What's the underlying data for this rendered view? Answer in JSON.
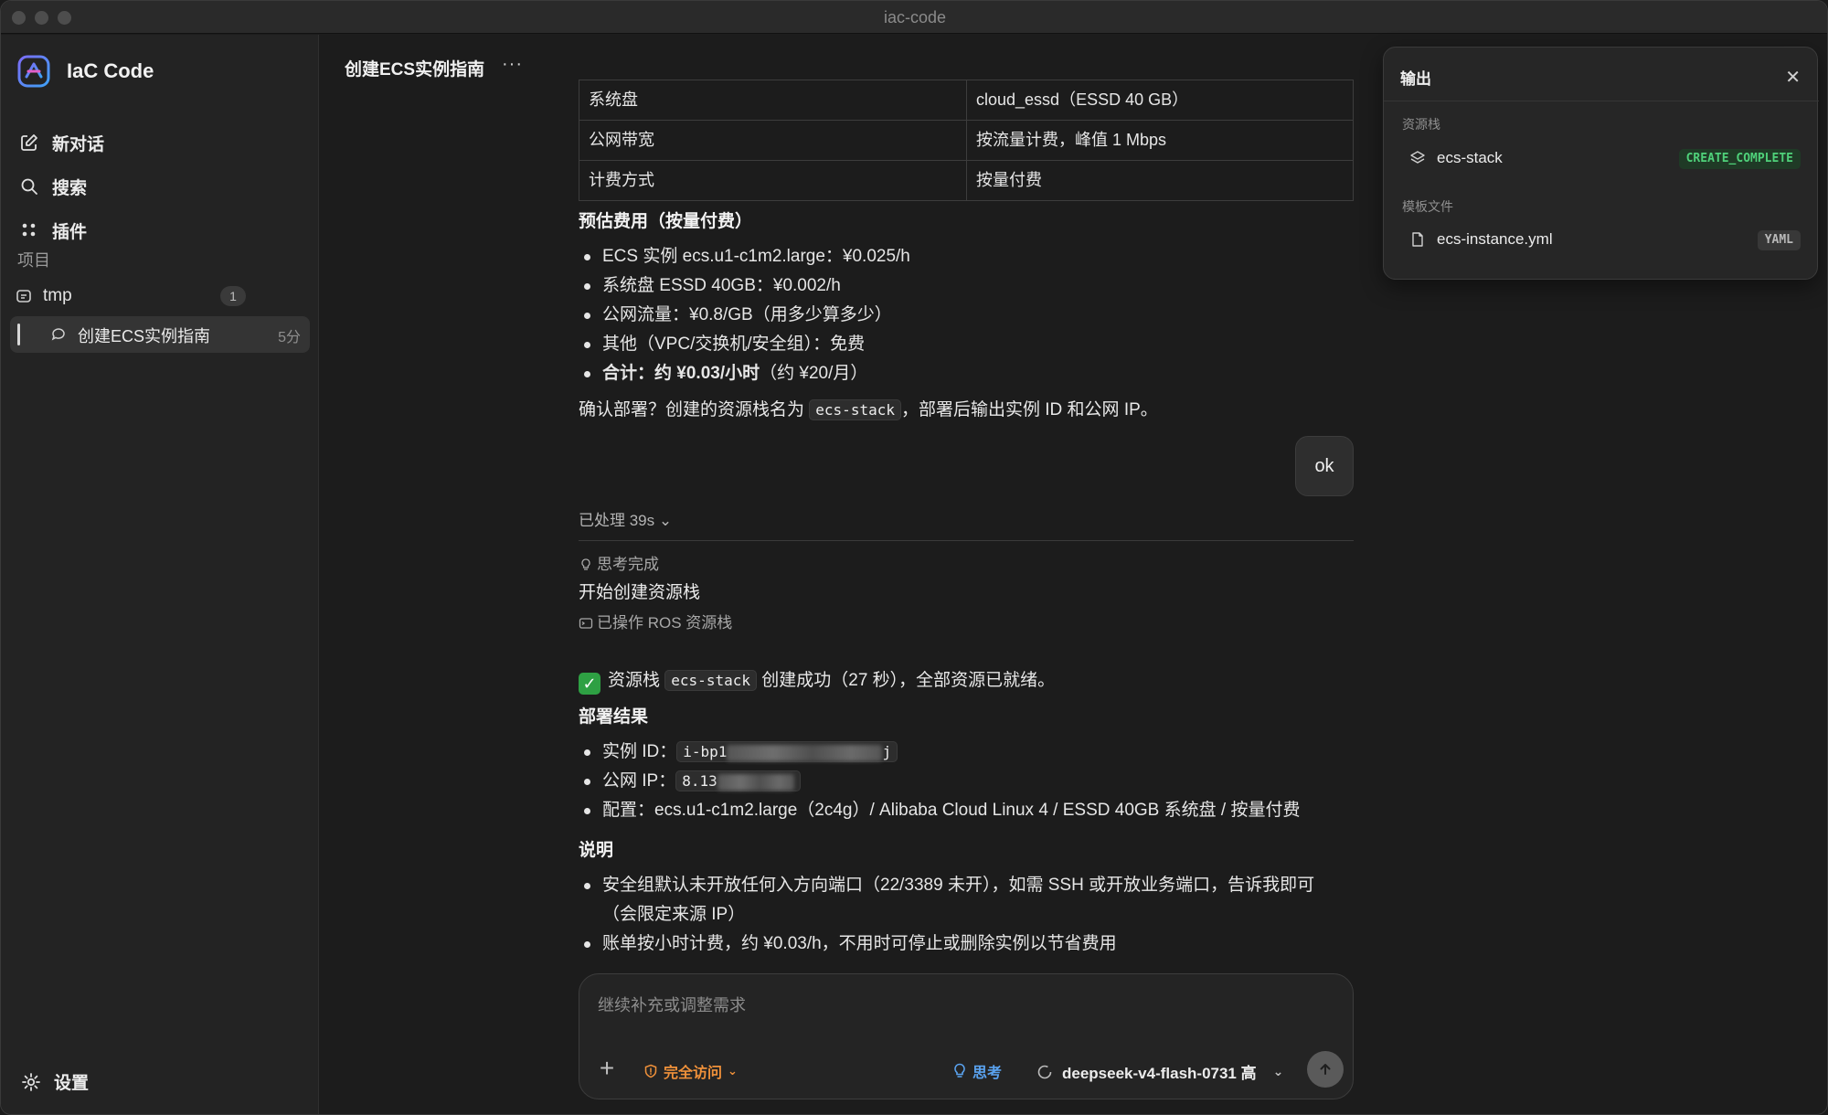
{
  "window": {
    "title": "iac-code"
  },
  "sidebar": {
    "brand": "IaC Code",
    "nav": [
      {
        "label": "新对话",
        "icon": "new-chat-icon"
      },
      {
        "label": "搜索",
        "icon": "search-icon"
      },
      {
        "label": "插件",
        "icon": "plugins-icon"
      }
    ],
    "projects_label": "项目",
    "project": {
      "name": "tmp",
      "count": "1"
    },
    "chat": {
      "title": "创建ECS实例指南",
      "age": "5分"
    },
    "settings_label": "设置"
  },
  "header": {
    "title": "创建ECS实例指南",
    "more": "···"
  },
  "spec_table": [
    [
      "系统盘",
      "cloud_essd（ESSD 40 GB）"
    ],
    [
      "公网带宽",
      "按流量计费，峰值 1 Mbps"
    ],
    [
      "计费方式",
      "按量付费"
    ]
  ],
  "cost": {
    "heading": "预估费用（按量付费）",
    "items": [
      "ECS 实例 ecs.u1-c1m2.large：¥0.025/h",
      "系统盘 ESSD 40GB：¥0.002/h",
      "公网流量：¥0.8/GB（用多少算多少）",
      "其他（VPC/交换机/安全组）：免费"
    ],
    "total_bold": "合计：约 ¥0.03/小时",
    "total_rest": "（约 ¥20/月）"
  },
  "confirm": {
    "pre": "确认部署？创建的资源栈名为 ",
    "code": "ecs-stack",
    "post": "，部署后输出实例 ID 和公网 IP。"
  },
  "user_message": "ok",
  "processed": "已处理 39s ⌄",
  "thinking_done": "思考完成",
  "start_line": "开始创建资源栈",
  "ros_line": "已操作 ROS 资源栈",
  "success": {
    "check": "✓",
    "pre": "资源栈 ",
    "code": "ecs-stack",
    "post": " 创建成功（27 秒），全部资源已就绪。"
  },
  "results": {
    "heading": "部署结果",
    "instance_label": "实例 ID：",
    "instance_prefix": "i-bp1",
    "instance_suffix": "j",
    "ip_label": "公网 IP：",
    "ip_prefix": "8.13",
    "config": "配置：ecs.u1-c1m2.large（2c4g）/ Alibaba Cloud Linux 4 / ESSD 40GB 系统盘 / 按量付费"
  },
  "notes": {
    "heading": "说明",
    "item1_line1": "安全组默认未开放任何入方向端口（22/3389 未开），如需 SSH 或开放业务端口，告诉我即可",
    "item1_line2": "（会限定来源 IP）",
    "item2": "账单按小时计费，约 ¥0.03/h，不用时可停止或删除实例以节省费用"
  },
  "composer": {
    "placeholder": "继续补充或调整需求",
    "access_label": "完全访问",
    "think_label": "思考",
    "model_label": "deepseek-v4-flash-0731 高"
  },
  "output_panel": {
    "title": "输出",
    "close": "✕",
    "stack_section": "资源栈",
    "stack_name": "ecs-stack",
    "stack_status": "CREATE_COMPLETE",
    "template_section": "模板文件",
    "template_name": "ecs-instance.yml",
    "template_type": "YAML"
  },
  "colors": {
    "accent_orange": "#f0913a",
    "accent_blue": "#5aa3f0",
    "status_green": "#4fd17a"
  }
}
